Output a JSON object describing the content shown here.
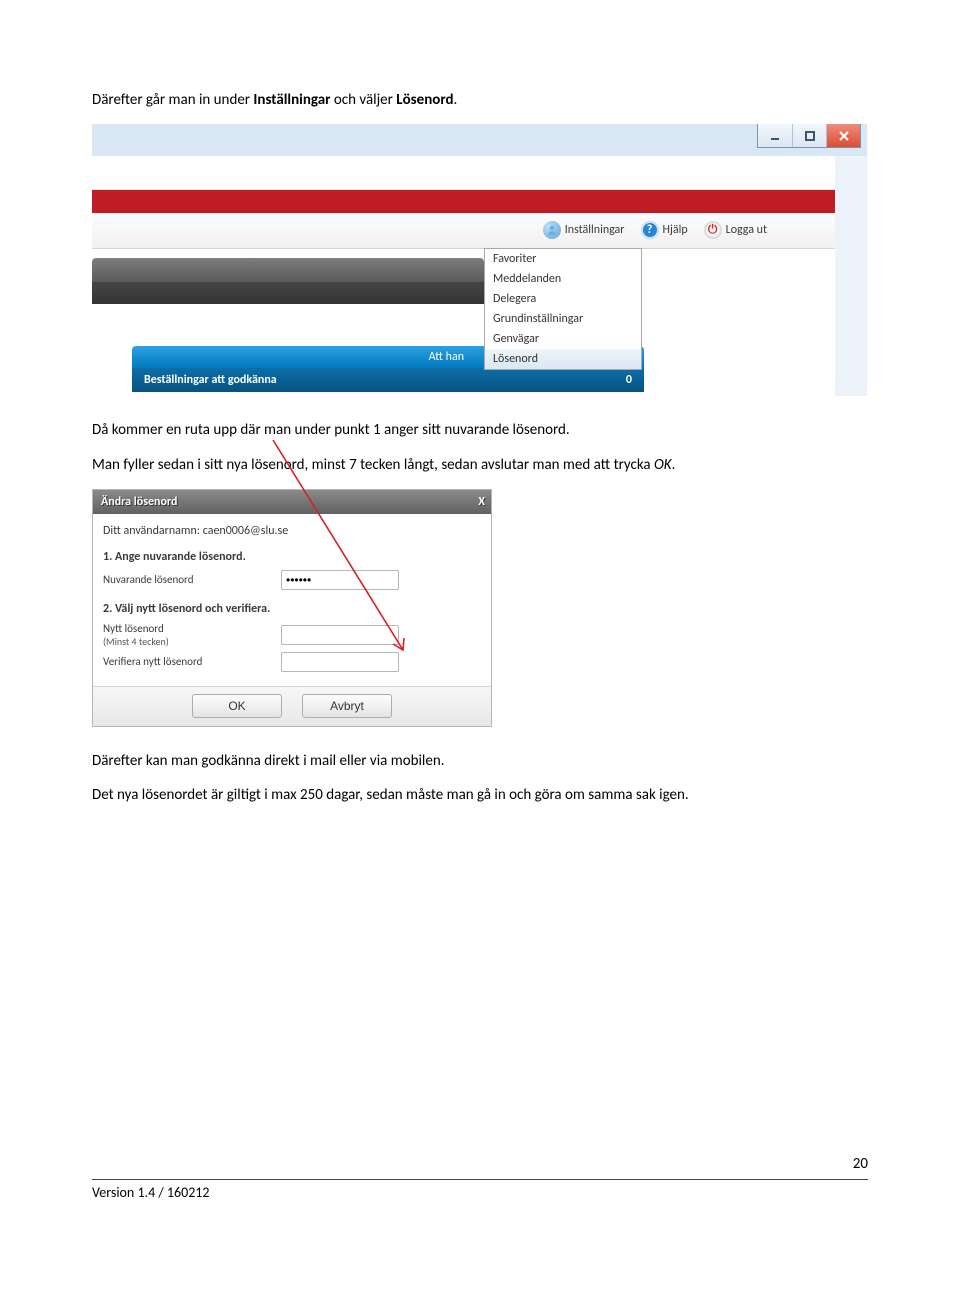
{
  "para": {
    "p1a": "Därefter går man in under ",
    "p1b": "Inställningar",
    "p1c": " och väljer ",
    "p1d": "Lösenord",
    "p1e": ".",
    "p2": "Då kommer en ruta upp där man under punkt 1 anger sitt nuvarande lösenord.",
    "p3a": "Man fyller sedan i sitt nya lösenord, minst 7 tecken långt, sedan avslutar man med att trycka ",
    "p3b": "OK",
    "p3c": ".",
    "p4": "Därefter kan man godkänna direkt i mail eller via mobilen.",
    "p5": "Det nya lösenordet är giltigt i max 250 dagar, sedan måste man gå in och göra om samma sak igen."
  },
  "shot1": {
    "toolbar": {
      "settings": "Inställningar",
      "help": "Hjälp",
      "logout": "Logga ut"
    },
    "dropdown": {
      "items": [
        "Favoriter",
        "Meddelanden",
        "Delegera",
        "Grundinställningar",
        "Genvägar",
        "Lösenord"
      ]
    },
    "bluebar1": "Att han",
    "bluebar2_label": "Beställningar att godkänna",
    "bluebar2_count": "0"
  },
  "shot2": {
    "title": "Ändra lösenord",
    "close": "X",
    "username_label": "Ditt användarnamn: caen0006@slu.se",
    "step1": "1. Ange nuvarande lösenord.",
    "current_label": "Nuvarande lösenord",
    "current_value": "••••••",
    "step2": "2. Välj nytt lösenord och verifiera.",
    "new_label": "Nytt lösenord",
    "new_sub": "(Minst 4 tecken)",
    "verify_label": "Verifiera nytt lösenord",
    "ok": "OK",
    "cancel": "Avbryt"
  },
  "footer": {
    "version": "Version 1.4  / 160212",
    "page": "20"
  }
}
